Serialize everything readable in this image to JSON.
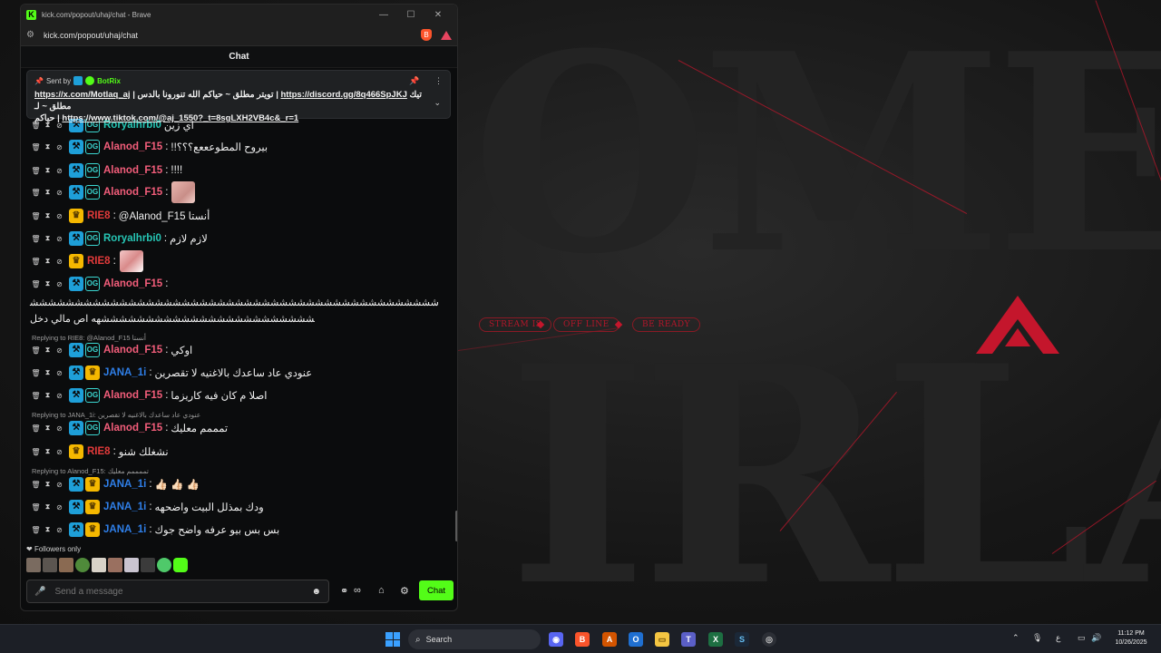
{
  "window": {
    "title": "kick.com/popout/uhaj/chat - Brave",
    "url": "kick.com/popout/uhaj/chat",
    "favicon": "K"
  },
  "chat": {
    "header": "Chat",
    "pinned": {
      "sent_by": "Sent by",
      "bot": "BotRix",
      "line1_a": "تيك مطلق ~ لـ",
      "line1_link1": "https://x.com/Motlaq_aj",
      "line1_b": " | تويتر مطلق ~ حياكم الله تنورونا بالدس | ",
      "line1_link2": "https://discord.gg/8q466SpJKJ",
      "line2_a": "حياكم | ",
      "line2_link": "https://www.tiktok.com/@aj_1550?_t=8sgLXH2VB4c&_r=1"
    },
    "messages": [
      {
        "user": "Alanod_F15",
        "text": "!!بيروح المطوعععع؟؟؟"
      },
      {
        "user": "Alanod_F15",
        "text": "!!!!"
      },
      {
        "user": "Alanod_F15",
        "text": ""
      },
      {
        "user": "RIE8",
        "text": "@Alanod_F15 أنستا"
      },
      {
        "user": "Roryalhrbi0",
        "text": "لازم لازم"
      },
      {
        "user": "RIE8",
        "text": ""
      },
      {
        "user": "Alanod_F15",
        "text": ""
      },
      {
        "user": "Alanod_F15",
        "text": "اوكي"
      },
      {
        "user": "JANA_1i",
        "text": "عنودي عاد ساعدك بالاغنيه لا تقصرين"
      },
      {
        "user": "Alanod_F15",
        "text": "اصلا م كان فيه كاريزما"
      },
      {
        "user": "Alanod_F15",
        "text": "تمممم معليك"
      },
      {
        "user": "RIE8",
        "text": "نشغلك شنو"
      },
      {
        "user": "JANA_1i",
        "text": "👍🏻 👍🏻 👍🏻"
      },
      {
        "user": "JANA_1i",
        "text": "ودك بمذلل البيت واضحهه"
      },
      {
        "user": "JANA_1i",
        "text": "بس بس بيو عرفه واضح جوك"
      }
    ],
    "partial_top": {
      "user": "Roryalhrbi0",
      "text": "اي زين"
    },
    "long_message": "ششششششششششششششششششششششششششششششششششششششششششششششششششششششششششششششششششششششهه اص مالي دخل",
    "replies": [
      "Replying to RIE8: @Alanod_F15 أنستا",
      "Replying to JANA_1i: عنودي عاد ساعدك بالاغنيه لا تقصرين",
      "Replying to Alanod_F15: تممممم معليك"
    ],
    "followers_only": "Followers only",
    "input_placeholder": "Send a message",
    "chat_button": "Chat"
  },
  "background": {
    "letters_top": "OME",
    "letters_bottom": "IRLA",
    "pills": [
      "STREAM IS",
      "OFF LINE",
      "BE READY"
    ]
  },
  "taskbar": {
    "search": "Search",
    "time": "11:12 PM",
    "date": "10/26/2025",
    "lang": "ع"
  },
  "colors": {
    "kick_green": "#53fc18",
    "accent_red": "#c4162c"
  }
}
